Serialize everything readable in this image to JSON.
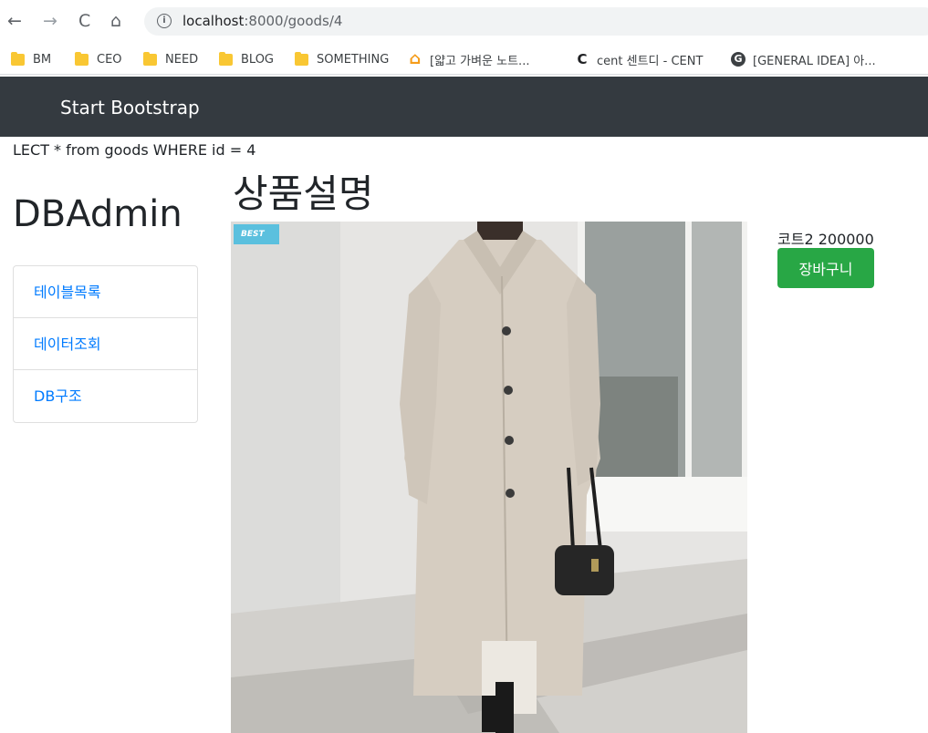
{
  "browser": {
    "url_host": "localhost",
    "url_path": ":8000/goods/4",
    "bookmarks": [
      {
        "label": "BM",
        "icon": "folder-icon"
      },
      {
        "label": "CEO",
        "icon": "folder-icon"
      },
      {
        "label": "NEED",
        "icon": "folder-icon"
      },
      {
        "label": "BLOG",
        "icon": "folder-icon"
      },
      {
        "label": "SOMETHING",
        "icon": "folder-icon"
      },
      {
        "label": "[얇고 가벼운 노트...",
        "icon": "home-favicon"
      },
      {
        "label": "cent 센트디 - CENT",
        "icon": "c-favicon"
      },
      {
        "label": "[GENERAL IDEA] 아...",
        "icon": "g-favicon"
      }
    ]
  },
  "navbar": {
    "brand": "Start Bootstrap",
    "bg_color": "#343a40"
  },
  "query_text": "LECT * from goods WHERE id = 4",
  "sidebar": {
    "title": "DBAdmin",
    "items": [
      {
        "label": "테이블목록"
      },
      {
        "label": "데이터조회"
      },
      {
        "label": "DB구조"
      }
    ]
  },
  "main": {
    "heading": "상품설명",
    "badge": "BEST",
    "product_info": "코트2 200000",
    "cart_button": "장바구니",
    "cart_button_color": "#28a745"
  }
}
